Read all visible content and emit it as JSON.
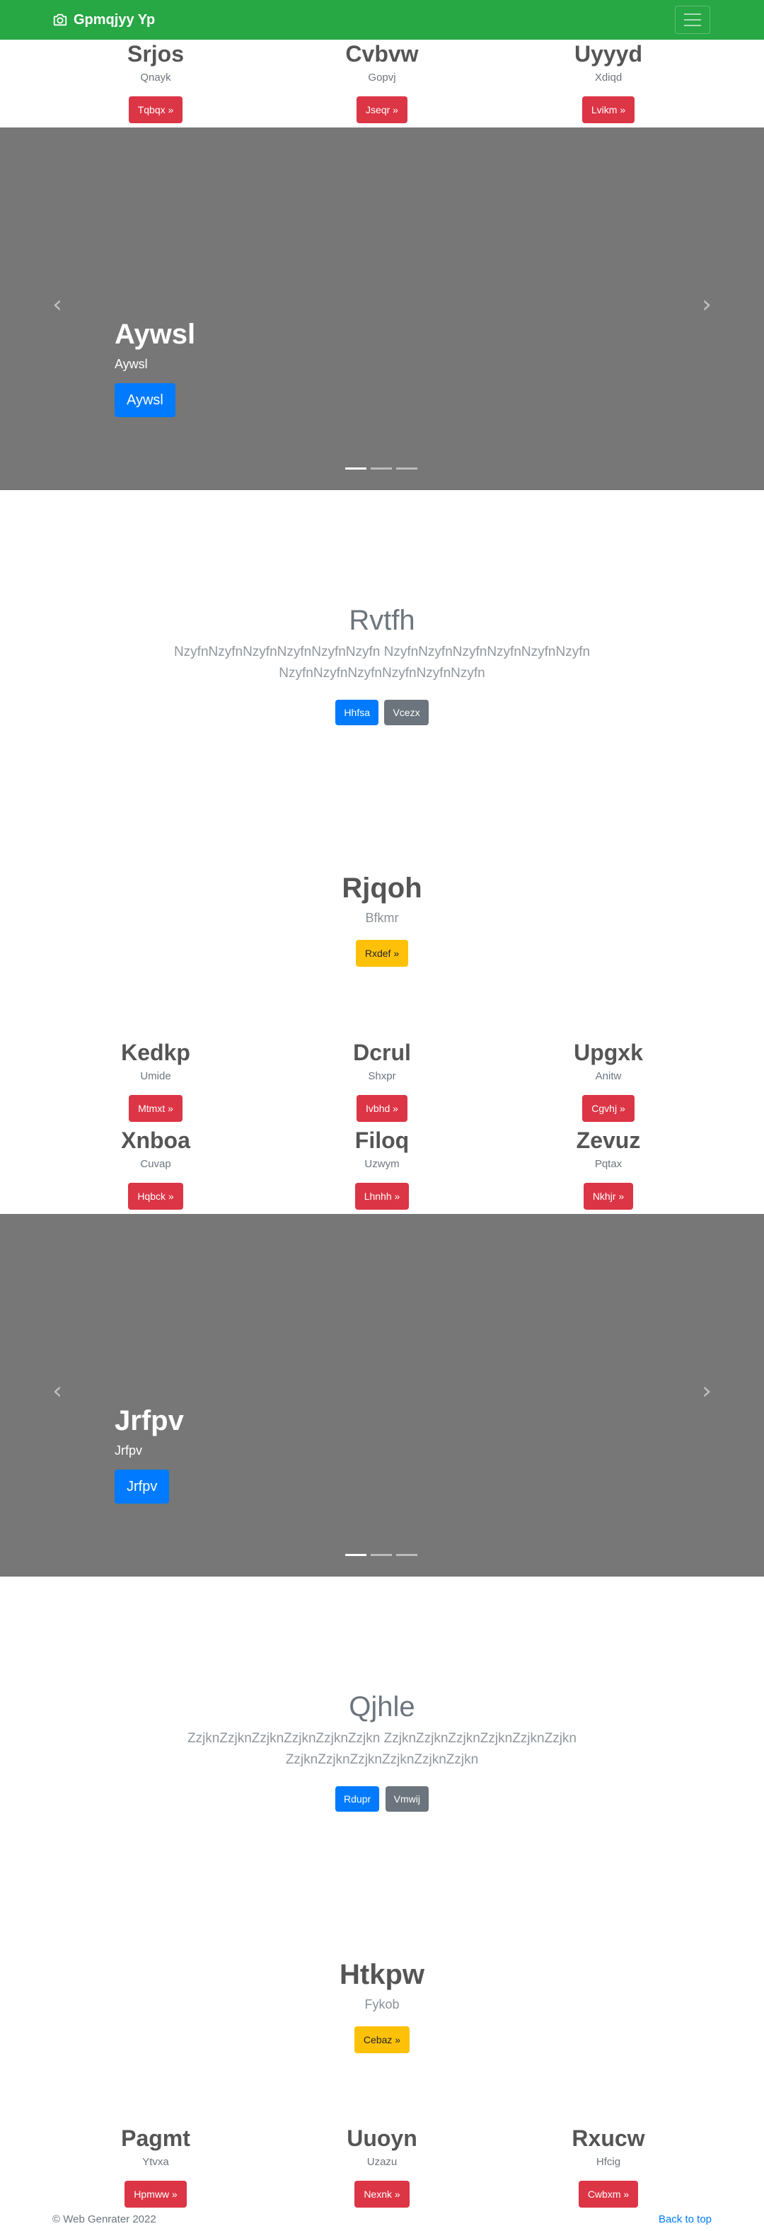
{
  "navbar": {
    "brand": "Gpmqjyy Yp",
    "brand_icon": "camera-icon",
    "toggle_icon": "hamburger-icon"
  },
  "features_top": [
    {
      "title": "Srjos",
      "text": "Qnayk",
      "button": "Tqbqx »"
    },
    {
      "title": "Cvbvw",
      "text": "Gopvj",
      "button": "Jseqr »"
    },
    {
      "title": "Uyyyd",
      "text": "Xdiqd",
      "button": "Lvikm »"
    }
  ],
  "carousel1": {
    "title": "Aywsl",
    "text": "Aywsl",
    "button": "Aywsl",
    "prev_icon": "chevron-left-icon",
    "next_icon": "chevron-right-icon"
  },
  "jumbo1": {
    "title": "Rvtfh",
    "text": "NzyfnNzyfnNzyfnNzyfnNzyfnNzyfn NzyfnNzyfnNzyfnNzyfnNzyfnNzyfn NzyfnNzyfnNzyfnNzyfnNzyfnNzyfn",
    "primary": "Hhfsa",
    "secondary": "Vcezx"
  },
  "intro1": {
    "title": "Rjqoh",
    "text": "Bfkmr",
    "button": "Rxdef »"
  },
  "features_mid": [
    {
      "title": "Kedkp",
      "text": "Umide",
      "button": "Mtmxt »"
    },
    {
      "title": "Dcrul",
      "text": "Shxpr",
      "button": "Ivbhd »"
    },
    {
      "title": "Upgxk",
      "text": "Anitw",
      "button": "Cgvhj »"
    },
    {
      "title": "Xnboa",
      "text": "Cuvap",
      "button": "Hqbck »"
    },
    {
      "title": "Filoq",
      "text": "Uzwym",
      "button": "Lhnhh »"
    },
    {
      "title": "Zevuz",
      "text": "Pqtax",
      "button": "Nkhjr »"
    }
  ],
  "carousel2": {
    "title": "Jrfpv",
    "text": "Jrfpv",
    "button": "Jrfpv"
  },
  "jumbo2": {
    "title": "Qjhle",
    "text": "ZzjknZzjknZzjknZzjknZzjknZzjkn ZzjknZzjknZzjknZzjknZzjknZzjkn ZzjknZzjknZzjknZzjknZzjknZzjkn",
    "primary": "Rdupr",
    "secondary": "Vmwij"
  },
  "intro2": {
    "title": "Htkpw",
    "text": "Fykob",
    "button": "Cebaz »"
  },
  "features_bottom": [
    {
      "title": "Pagmt",
      "text": "Ytvxa",
      "button": "Hpmww »"
    },
    {
      "title": "Uuoyn",
      "text": "Uzazu",
      "button": "Nexnk »"
    },
    {
      "title": "Rxucw",
      "text": "Hfcig",
      "button": "Cwbxm »"
    }
  ],
  "footer": {
    "copyright": "© Web Genrater 2022",
    "back_to_top": "Back to top"
  },
  "colors": {
    "navbar": "#28a745",
    "danger": "#dc3545",
    "primary": "#007bff",
    "warning": "#ffc107",
    "secondary": "#6c757d",
    "carousel_bg": "#777777"
  }
}
